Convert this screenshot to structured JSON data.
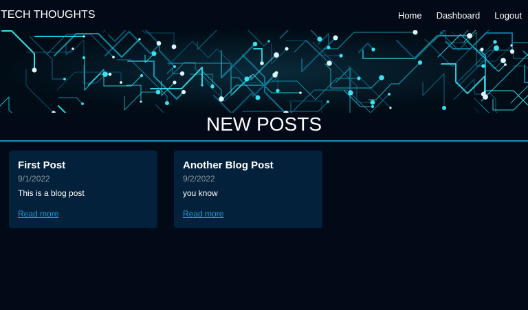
{
  "navbar": {
    "brand": "TECH THOUGHTS",
    "links": [
      "Home",
      "Dashboard",
      "Logout"
    ]
  },
  "banner": {
    "image": "circuit-board-image"
  },
  "page": {
    "title": "NEW POSTS"
  },
  "posts": [
    {
      "title": "First Post",
      "date": "9/1/2022",
      "body": "This is a blog post",
      "link_label": "Read more"
    },
    {
      "title": "Another Blog Post",
      "date": "9/2/2022",
      "body": "you know",
      "link_label": "Read more"
    }
  ],
  "colors": {
    "background": "#020a17",
    "card": "#03213a",
    "accent": "#1b8cc4",
    "link": "#1b9ad6",
    "muted": "#8c98a4"
  }
}
